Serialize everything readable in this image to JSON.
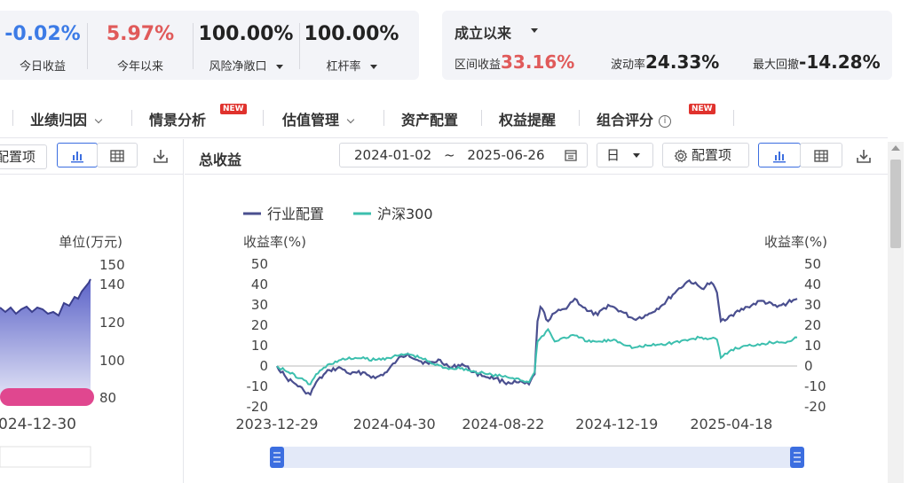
{
  "stats": [
    {
      "value": "-0.02%",
      "label": "今日收益",
      "color": "#3c7be6",
      "dropdown": false
    },
    {
      "value": "5.97%",
      "label": "今年以来",
      "color": "#e05a5a",
      "dropdown": false
    },
    {
      "value": "100.00%",
      "label": "风险净敞口",
      "color": "#222222",
      "dropdown": true
    },
    {
      "value": "100.00%",
      "label": "杠杆率",
      "color": "#222222",
      "dropdown": true
    }
  ],
  "period": {
    "title": "成立以来",
    "items": [
      {
        "label": "区间收益",
        "value": "33.16%",
        "color": "#e05a5a"
      },
      {
        "label": "波动率",
        "value": "24.33%",
        "color": "#222222"
      },
      {
        "label": "最大回撤",
        "value": "-14.28%",
        "color": "#222222"
      }
    ]
  },
  "nav": [
    {
      "label": "业绩归因",
      "dropdown": true,
      "badge": "",
      "info": false
    },
    {
      "label": "情景分析",
      "dropdown": false,
      "badge": "NEW",
      "info": false
    },
    {
      "label": "估值管理",
      "dropdown": true,
      "badge": "",
      "info": false
    },
    {
      "label": "资产配置",
      "dropdown": false,
      "badge": "",
      "info": false
    },
    {
      "label": "权益提醒",
      "dropdown": false,
      "badge": "",
      "info": false
    },
    {
      "label": "组合评分",
      "dropdown": false,
      "badge": "NEW",
      "info": true
    }
  ],
  "left_panel": {
    "config_label": "配置项",
    "unit_label": "单位(万元)",
    "yticks": [
      "150",
      "140",
      "120",
      "100",
      "80"
    ],
    "xtick": "024-12-30"
  },
  "right_panel": {
    "title": "总收益",
    "date_start": "2024-01-02",
    "date_sep": "~",
    "date_end": "2025-06-26",
    "freq": "日",
    "config_label": "配置项"
  },
  "colors": {
    "series1": "#4a4f8f",
    "series2": "#3cbfae",
    "accent": "#3c6ee0",
    "badge": "#e0322d"
  },
  "chart_data": {
    "type": "line",
    "legend": "top-left",
    "y_left_label": "收益率(%)",
    "y_right_label": "收益率(%)",
    "ylim": [
      -20,
      50
    ],
    "y_left_ticks": [
      50,
      40,
      30,
      20,
      10,
      0,
      -10,
      -20
    ],
    "y_right_ticks": [
      50,
      40,
      30,
      20,
      10,
      0,
      -10,
      -20
    ],
    "x_ticks": [
      "2023-12-29",
      "2024-04-30",
      "2024-08-22",
      "2024-12-19",
      "2025-04-18"
    ],
    "x_range": [
      "2023-12-29",
      "2025-06-26"
    ],
    "series": [
      {
        "name": "行业配置",
        "points": [
          [
            "2023-12-29",
            0
          ],
          [
            "2024-01-08",
            -6
          ],
          [
            "2024-01-18",
            -9
          ],
          [
            "2024-01-26",
            -12
          ],
          [
            "2024-02-02",
            -14
          ],
          [
            "2024-02-08",
            -8
          ],
          [
            "2024-02-22",
            -2
          ],
          [
            "2024-03-05",
            -1
          ],
          [
            "2024-03-15",
            -4
          ],
          [
            "2024-03-28",
            -3
          ],
          [
            "2024-04-10",
            -6
          ],
          [
            "2024-04-22",
            -3
          ],
          [
            "2024-05-03",
            3
          ],
          [
            "2024-05-14",
            6
          ],
          [
            "2024-05-24",
            3
          ],
          [
            "2024-06-05",
            1
          ],
          [
            "2024-06-17",
            3
          ],
          [
            "2024-06-28",
            -1
          ],
          [
            "2024-07-10",
            1
          ],
          [
            "2024-07-22",
            -3
          ],
          [
            "2024-08-02",
            -5
          ],
          [
            "2024-08-14",
            -6
          ],
          [
            "2024-08-23",
            -8
          ],
          [
            "2024-09-05",
            -8
          ],
          [
            "2024-09-18",
            -9
          ],
          [
            "2024-09-24",
            -4
          ],
          [
            "2024-09-27",
            22
          ],
          [
            "2024-09-30",
            29
          ],
          [
            "2024-10-08",
            22
          ],
          [
            "2024-10-15",
            26
          ],
          [
            "2024-10-25",
            28
          ],
          [
            "2024-11-05",
            33
          ],
          [
            "2024-11-18",
            27
          ],
          [
            "2024-11-29",
            25
          ],
          [
            "2024-12-10",
            30
          ],
          [
            "2024-12-23",
            27
          ],
          [
            "2025-01-06",
            23
          ],
          [
            "2025-01-20",
            25
          ],
          [
            "2025-02-05",
            30
          ],
          [
            "2025-02-20",
            37
          ],
          [
            "2025-03-05",
            42
          ],
          [
            "2025-03-18",
            38
          ],
          [
            "2025-03-28",
            41
          ],
          [
            "2025-04-03",
            36
          ],
          [
            "2025-04-07",
            22
          ],
          [
            "2025-04-18",
            25
          ],
          [
            "2025-05-05",
            29
          ],
          [
            "2025-05-20",
            32
          ],
          [
            "2025-06-05",
            29
          ],
          [
            "2025-06-16",
            31
          ],
          [
            "2025-06-26",
            33
          ]
        ]
      },
      {
        "name": "沪深300",
        "points": [
          [
            "2023-12-29",
            0
          ],
          [
            "2024-01-10",
            -3
          ],
          [
            "2024-01-22",
            -6
          ],
          [
            "2024-02-02",
            -9
          ],
          [
            "2024-02-08",
            -4
          ],
          [
            "2024-02-22",
            1
          ],
          [
            "2024-03-05",
            3
          ],
          [
            "2024-03-20",
            4
          ],
          [
            "2024-04-10",
            3
          ],
          [
            "2024-04-22",
            4
          ],
          [
            "2024-05-03",
            5
          ],
          [
            "2024-05-14",
            6
          ],
          [
            "2024-05-28",
            4
          ],
          [
            "2024-06-10",
            1
          ],
          [
            "2024-06-24",
            -1
          ],
          [
            "2024-07-10",
            -1
          ],
          [
            "2024-07-24",
            -3
          ],
          [
            "2024-08-06",
            -4
          ],
          [
            "2024-08-20",
            -5
          ],
          [
            "2024-09-05",
            -6
          ],
          [
            "2024-09-18",
            -8
          ],
          [
            "2024-09-24",
            -3
          ],
          [
            "2024-09-27",
            12
          ],
          [
            "2024-10-08",
            18
          ],
          [
            "2024-10-15",
            12
          ],
          [
            "2024-10-25",
            14
          ],
          [
            "2024-11-05",
            15
          ],
          [
            "2024-11-18",
            12
          ],
          [
            "2024-12-02",
            12
          ],
          [
            "2024-12-16",
            13
          ],
          [
            "2025-01-06",
            9
          ],
          [
            "2025-01-20",
            10
          ],
          [
            "2025-02-10",
            11
          ],
          [
            "2025-03-05",
            13
          ],
          [
            "2025-03-18",
            14
          ],
          [
            "2025-04-03",
            13
          ],
          [
            "2025-04-07",
            4
          ],
          [
            "2025-04-18",
            8
          ],
          [
            "2025-05-05",
            10
          ],
          [
            "2025-05-20",
            11
          ],
          [
            "2025-06-05",
            12
          ],
          [
            "2025-06-16",
            12
          ],
          [
            "2025-06-26",
            14
          ]
        ]
      }
    ]
  }
}
